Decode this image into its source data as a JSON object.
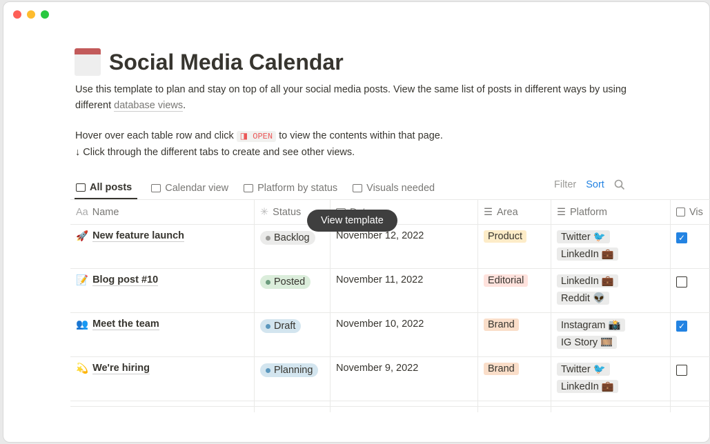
{
  "page": {
    "icon": "🗓️",
    "title": "Social Media Calendar",
    "desc1": "Use this template to plan and stay on top of all your social media posts. View the same list of posts in different ways by using different ",
    "desc_link": "database views",
    "desc1_end": ".",
    "hover_a": "Hover over each table row and click ",
    "open_label": "◨ OPEN",
    "hover_b": " to view the contents within that page.",
    "tabs_hint": "↓ Click through the different tabs to create and see other views."
  },
  "tabs": [
    {
      "label": "All posts",
      "icon": "table-icon"
    },
    {
      "label": "Calendar view",
      "icon": "calendar-icon"
    },
    {
      "label": "Platform by status",
      "icon": "board-icon"
    },
    {
      "label": "Visuals needed",
      "icon": "board-icon"
    }
  ],
  "toolbar": {
    "filter": "Filter",
    "sort": "Sort",
    "search": "search-icon"
  },
  "tooltip": "View template",
  "columns": {
    "name": "Name",
    "name_icon": "Aa",
    "status": "Status",
    "date": "Date",
    "area": "Area",
    "platform": "Platform",
    "visuals": "Vis"
  },
  "rows": [
    {
      "emoji": "🚀",
      "name": "New feature launch",
      "status": "Backlog",
      "date": "November 12, 2022",
      "area": "Product",
      "platforms": [
        "Twitter 🐦",
        "LinkedIn 💼"
      ],
      "visual": true
    },
    {
      "emoji": "📝",
      "name": "Blog post #10",
      "status": "Posted",
      "date": "November 11, 2022",
      "area": "Editorial",
      "platforms": [
        "LinkedIn 💼",
        "Reddit 👽"
      ],
      "visual": false
    },
    {
      "emoji": "👥",
      "name": "Meet the team",
      "status": "Draft",
      "date": "November 10, 2022",
      "area": "Brand",
      "platforms": [
        "Instagram 📸",
        "IG Story 🎞️"
      ],
      "visual": true
    },
    {
      "emoji": "💫",
      "name": "We're hiring",
      "status": "Planning",
      "date": "November 9, 2022",
      "area": "Brand",
      "platforms": [
        "Twitter 🐦",
        "LinkedIn 💼"
      ],
      "visual": false
    }
  ],
  "colors": {
    "Backlog": [
      "#ebebea",
      "#9b9a97"
    ],
    "Posted": [
      "#dbeddb",
      "#6c9b7d"
    ],
    "Draft": [
      "#d3e5ef",
      "#5b97bd"
    ],
    "Planning": [
      "#d3e5ef",
      "#5b97bd"
    ],
    "Product": "#fdecc8",
    "Editorial": "#ffe2dd",
    "Brand": "#fadec9",
    "accent": "#2383e2"
  }
}
